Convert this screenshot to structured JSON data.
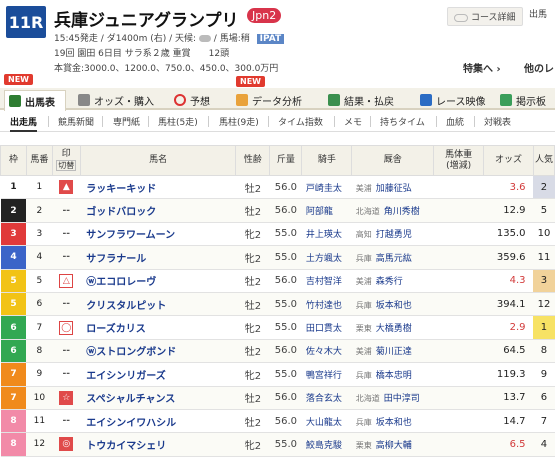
{
  "race": {
    "number": "11R",
    "name": "兵庫ジュニアグランプリ",
    "grade": "Jpn2",
    "info1": "15:45発走 / ダ1400m (右) / 天候:",
    "info1b": " / 馬場:稍",
    "ipat": "IPAT",
    "info2": "19回 園田 6日目 サラ系２歳 重賞　　12頭",
    "info3": "本賞金:3000.0、1200.0、750.0、450.0、300.0万円"
  },
  "header_links": {
    "course_detail": "コース詳細",
    "more": "出馬",
    "feature": "特集へ ›",
    "other": "他のレ"
  },
  "badges": {
    "new1": "NEW",
    "new2": "NEW"
  },
  "tabs": [
    "出馬表",
    "オッズ・購入",
    "予想",
    "データ分析",
    "結果・払戻",
    "レース映像",
    "掲示板"
  ],
  "subtabs": [
    "出走馬",
    "競馬新聞",
    "専門紙",
    "馬柱(5走)",
    "馬柱(9走)",
    "タイム指数",
    "メモ",
    "持ちタイム",
    "血統",
    "対戦表"
  ],
  "table_headers": {
    "waku": "枠",
    "umaban": "馬番",
    "mark": "印",
    "mark_sub": "切替",
    "horse": "馬名",
    "sexage": "性齢",
    "weight": "斤量",
    "jockey": "騎手",
    "trainer": "厩舎",
    "bodyweight": "馬体重",
    "bodyweight_sub": "(増減)",
    "odds": "オッズ",
    "pop": "人気"
  },
  "colors": {
    "w1": "#ffffff",
    "w2": "#222222",
    "w3": "#e03a3a",
    "w4": "#3b64c8",
    "w5": "#f2c316",
    "w6": "#32a852",
    "w7": "#f08a1c",
    "w8": "#f28aa8"
  },
  "rows": [
    {
      "waku": "1",
      "num": "1",
      "mark": "▲",
      "mark_type": "red",
      "horse": "ラッキーキッド",
      "sex": "牡2",
      "weight": "56.0",
      "jockey": "戸崎圭太",
      "region": "美浦",
      "trainer": "加藤征弘",
      "odds": "3.6",
      "hot": true,
      "pop": "2"
    },
    {
      "waku": "2",
      "num": "2",
      "mark": "--",
      "mark_type": "dash",
      "horse": "ゴッドバロック",
      "sex": "牡2",
      "weight": "56.0",
      "jockey": "阿部龍",
      "region": "北海道",
      "trainer": "角川秀樹",
      "odds": "12.9",
      "hot": false,
      "pop": "5"
    },
    {
      "waku": "3",
      "num": "3",
      "mark": "--",
      "mark_type": "dash",
      "horse": "サンフラワームーン",
      "sex": "牝2",
      "weight": "55.0",
      "jockey": "井上瑛太",
      "region": "高知",
      "trainer": "打越勇児",
      "odds": "135.0",
      "hot": false,
      "pop": "10"
    },
    {
      "waku": "4",
      "num": "4",
      "mark": "--",
      "mark_type": "dash",
      "horse": "サフラナール",
      "sex": "牝2",
      "weight": "55.0",
      "jockey": "土方颯太",
      "region": "兵庫",
      "trainer": "高馬元紘",
      "odds": "359.6",
      "hot": false,
      "pop": "11"
    },
    {
      "waku": "5",
      "num": "5",
      "mark": "△",
      "mark_type": "outline",
      "horse": "ⓦエコロレーヴ",
      "sex": "牡2",
      "weight": "56.0",
      "jockey": "吉村智洋",
      "region": "美浦",
      "trainer": "森秀行",
      "odds": "4.3",
      "hot": true,
      "pop": "3"
    },
    {
      "waku": "5",
      "num": "6",
      "mark": "--",
      "mark_type": "dash",
      "horse": "クリスタルピット",
      "sex": "牡2",
      "weight": "55.0",
      "jockey": "竹村達也",
      "region": "兵庫",
      "trainer": "坂本和也",
      "odds": "394.1",
      "hot": false,
      "pop": "12"
    },
    {
      "waku": "6",
      "num": "7",
      "mark": "◯",
      "mark_type": "outline",
      "horse": "ローズカリス",
      "sex": "牝2",
      "weight": "55.0",
      "jockey": "田口貫太",
      "region": "栗東",
      "trainer": "大橋勇樹",
      "odds": "2.9",
      "hot": true,
      "pop": "1"
    },
    {
      "waku": "6",
      "num": "8",
      "mark": "--",
      "mark_type": "dash",
      "horse": "ⓦストロングボンド",
      "sex": "牡2",
      "weight": "56.0",
      "jockey": "佐々木大",
      "region": "美浦",
      "trainer": "菊川正達",
      "odds": "64.5",
      "hot": false,
      "pop": "8"
    },
    {
      "waku": "7",
      "num": "9",
      "mark": "--",
      "mark_type": "dash",
      "horse": "エイシンリガーズ",
      "sex": "牝2",
      "weight": "55.0",
      "jockey": "鴨宮祥行",
      "region": "兵庫",
      "trainer": "橋本忠明",
      "odds": "119.3",
      "hot": false,
      "pop": "9"
    },
    {
      "waku": "7",
      "num": "10",
      "mark": "☆",
      "mark_type": "red",
      "horse": "スペシャルチャンス",
      "sex": "牡2",
      "weight": "56.0",
      "jockey": "落合玄太",
      "region": "北海道",
      "trainer": "田中淳司",
      "odds": "13.7",
      "hot": false,
      "pop": "6"
    },
    {
      "waku": "8",
      "num": "11",
      "mark": "--",
      "mark_type": "dash",
      "horse": "エイシンイワハシル",
      "sex": "牡2",
      "weight": "56.0",
      "jockey": "大山龍太",
      "region": "兵庫",
      "trainer": "坂本和也",
      "odds": "14.7",
      "hot": false,
      "pop": "7"
    },
    {
      "waku": "8",
      "num": "12",
      "mark": "◎",
      "mark_type": "red",
      "horse": "トウカイマシェリ",
      "sex": "牝2",
      "weight": "55.0",
      "jockey": "鮫島克駿",
      "region": "栗東",
      "trainer": "高柳大輔",
      "odds": "6.5",
      "hot": true,
      "pop": "4"
    }
  ]
}
